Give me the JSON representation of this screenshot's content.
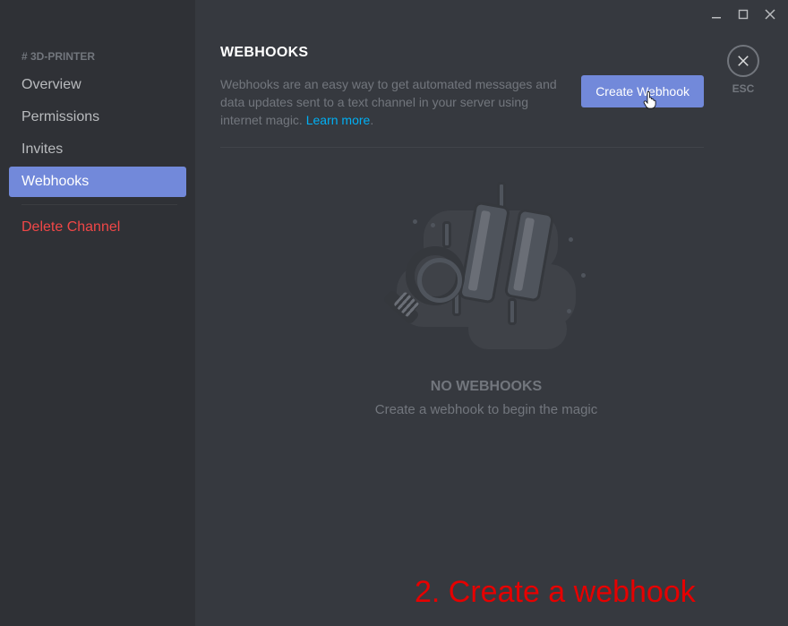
{
  "titlebar": {
    "minimize": "minimize",
    "maximize": "maximize",
    "close": "close"
  },
  "sidebar": {
    "header": "# 3D-PRINTER",
    "items": [
      {
        "label": "Overview",
        "active": false
      },
      {
        "label": "Permissions",
        "active": false
      },
      {
        "label": "Invites",
        "active": false
      },
      {
        "label": "Webhooks",
        "active": true
      }
    ],
    "danger": {
      "label": "Delete Channel"
    }
  },
  "close": {
    "esc": "ESC"
  },
  "page": {
    "title": "WEBHOOKS",
    "intro": "Webhooks are an easy way to get automated messages and data updates sent to a text channel in your server using internet magic. ",
    "learn_more": "Learn more",
    "period": ".",
    "create_label": "Create Webhook"
  },
  "empty": {
    "title": "NO WEBHOOKS",
    "subtitle": "Create a webhook to begin the magic"
  },
  "annotation": {
    "text": "2. Create a webhook"
  },
  "colors": {
    "accent": "#7289da",
    "danger": "#f04747",
    "link": "#00b0f4"
  }
}
